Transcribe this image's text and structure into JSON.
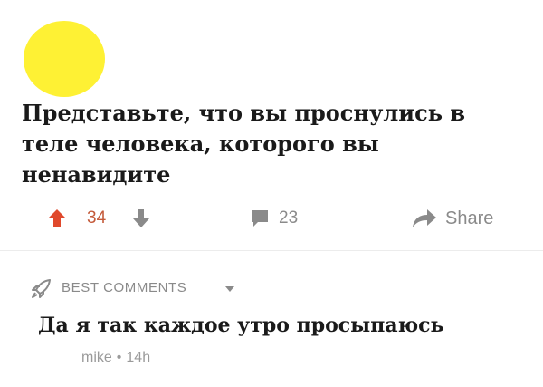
{
  "colors": {
    "avatar": "#fef134",
    "upvote": "#e0492c",
    "downvote": "#8a8a8a",
    "score": "#c45a3a",
    "muted": "#8a8a8a"
  },
  "post": {
    "avatar_icon": "avatar-circle",
    "title": "Представьте, что вы проснулись в теле человека, которого вы ненавидите",
    "score": "34",
    "comments_count": "23",
    "share_label": "Share"
  },
  "best_comments": {
    "label": "BEST COMMENTS",
    "icon": "rocket-icon",
    "comment": {
      "text": "Да я так каждое утро просыпаюсь",
      "author": "mike",
      "separator": "•",
      "age": "14h"
    }
  }
}
